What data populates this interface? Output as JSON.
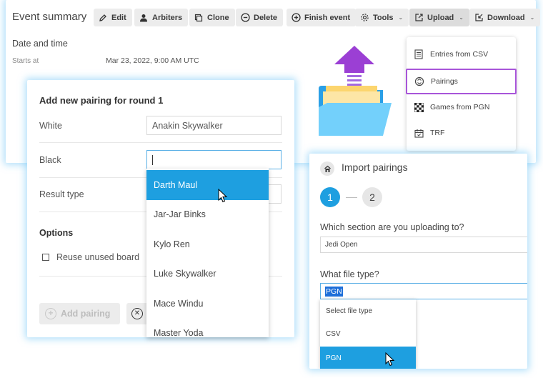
{
  "summary": {
    "title": "Event summary",
    "toolbar": {
      "edit": "Edit",
      "arbiters": "Arbiters",
      "clone": "Clone",
      "delete": "Delete",
      "finish": "Finish event",
      "tools": "Tools",
      "upload": "Upload",
      "download": "Download"
    },
    "date_heading": "Date and time",
    "starts_label": "Starts at",
    "starts_value": "Mar 23, 2022, 9:00 AM UTC"
  },
  "upload_menu": {
    "items": [
      {
        "label": "Entries from CSV",
        "icon": "csv-file-icon"
      },
      {
        "label": "Pairings",
        "icon": "pairings-icon"
      },
      {
        "label": "Games from PGN",
        "icon": "chessboard-icon"
      },
      {
        "label": "TRF",
        "icon": "calendar-icon"
      }
    ],
    "selected": "Pairings",
    "highlight_color": "#a855d9"
  },
  "add_pairing": {
    "title": "Add new pairing for round 1",
    "white_label": "White",
    "white_value": "Anakin Skywalker",
    "black_label": "Black",
    "black_value": "",
    "result_label": "Result type",
    "options_title": "Options",
    "reuse_label": "Reuse unused board",
    "add_button": "Add pairing"
  },
  "player_dropdown": {
    "items": [
      "Darth Maul",
      "Jar-Jar Binks",
      "Kylo Ren",
      "Luke Skywalker",
      "Mace Windu",
      "Master Yoda"
    ],
    "highlighted": "Darth Maul"
  },
  "import_panel": {
    "title": "Import pairings",
    "steps": [
      "1",
      "2"
    ],
    "active_step": "1",
    "section_question": "Which section are you uploading to?",
    "section_value": "Jedi Open",
    "filetype_question": "What file type?",
    "filetype_value": "PGN",
    "filetype_options": [
      "Select file type",
      "CSV",
      "PGN"
    ],
    "highlighted_option": "PGN"
  },
  "colors": {
    "accent": "#1e9fe0",
    "glow": "#78c8f5",
    "button_bg": "#ececec"
  }
}
